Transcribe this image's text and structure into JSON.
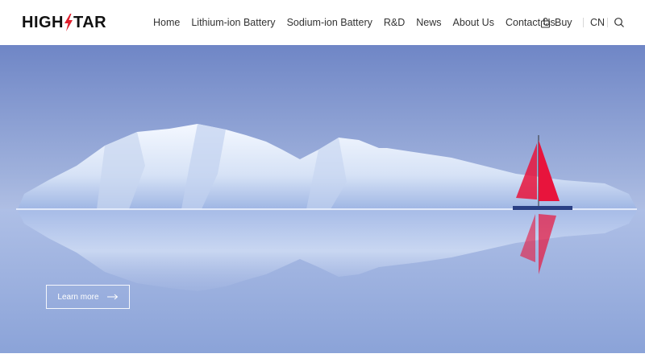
{
  "header": {
    "logo_text_left": "HIGH",
    "logo_text_right": "TAR",
    "nav": [
      {
        "label": "Home"
      },
      {
        "label": "Lithium-ion Battery"
      },
      {
        "label": "Sodium-ion Battery"
      },
      {
        "label": "R&D"
      },
      {
        "label": "News"
      },
      {
        "label": "About Us"
      },
      {
        "label": "Contact Us"
      }
    ],
    "buy_label": "Buy",
    "lang_label": "CN",
    "icons": {
      "buy": "bag-icon",
      "search": "search-icon",
      "logo": "lightning-bolt-icon"
    }
  },
  "hero": {
    "learn_more_label": "Learn more",
    "arrow_icon": "arrow-right-icon"
  },
  "colors": {
    "brand_red": "#e0202e",
    "sky_top": "#6f86c6",
    "sail_red": "#e8143c"
  }
}
